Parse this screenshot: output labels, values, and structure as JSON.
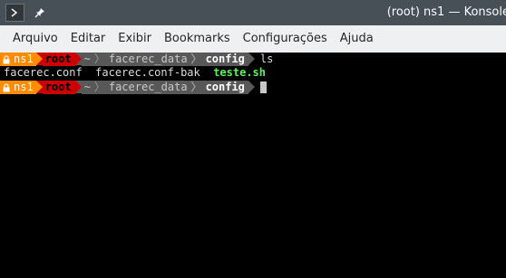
{
  "window": {
    "title": "(root) ns1 — Konsole"
  },
  "titlebar": {
    "app_icon": "terminal-icon",
    "pin_icon": "pin-icon"
  },
  "menu": {
    "items": [
      "Arquivo",
      "Editar",
      "Exibir",
      "Bookmarks",
      "Configurações",
      "Ajuda"
    ]
  },
  "terminal": {
    "prompt1": {
      "host": "ns1",
      "user": "root",
      "home": "~",
      "dir1": "facerec_data",
      "dir2": "config",
      "command": "ls"
    },
    "output": {
      "file1": "facerec.conf",
      "file2": "facerec.conf-bak",
      "file3": "teste.sh"
    },
    "prompt2": {
      "host": "ns1",
      "user": "root",
      "home": "~",
      "dir1": "facerec_data",
      "dir2": "config"
    }
  },
  "colors": {
    "host_bg": "#ff8c00",
    "user_bg": "#cc0000",
    "path_bg": "#585858",
    "exec_file": "#5af25a",
    "titlebar_bg": "#475057",
    "menubar_bg": "#eff0f1"
  }
}
